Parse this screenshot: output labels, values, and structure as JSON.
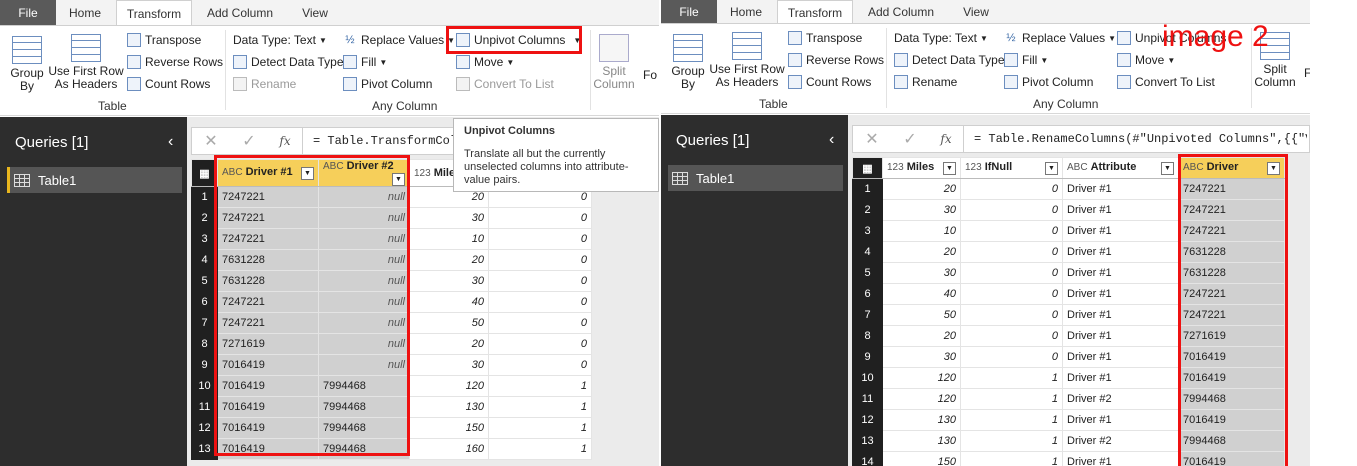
{
  "left": {
    "menu": {
      "file": "File",
      "tabs": [
        "Home",
        "Transform",
        "Add Column",
        "View"
      ],
      "active": "Transform"
    },
    "ribbon": {
      "group_by": "Group By",
      "use_first_row": "Use First Row As Headers",
      "transpose": "Transpose",
      "reverse_rows": "Reverse Rows",
      "count_rows": "Count Rows",
      "table_group": "Table",
      "data_type": "Data Type: Text",
      "detect_data_type": "Detect Data Type",
      "rename": "Rename",
      "replace_values": "Replace Values",
      "fill": "Fill",
      "pivot_column": "Pivot Column",
      "unpivot_columns": "Unpivot Columns",
      "move": "Move",
      "convert_to_list": "Convert To List",
      "any_column_group": "Any Column",
      "split_column": "Split Column",
      "fo_partial": "Fo"
    },
    "queries": {
      "title": "Queries [1]",
      "items": [
        "Table1"
      ]
    },
    "formula": "= Table.TransformColu",
    "tooltip": {
      "title": "Unpivot Columns",
      "body": "Translate all but the currently unselected columns into attribute-value pairs."
    },
    "columns": [
      {
        "type": "ABC",
        "name": "Driver #1"
      },
      {
        "type": "ABC",
        "name": "Driver #2"
      },
      {
        "type": "123",
        "name": "Mile"
      },
      {
        "type": "",
        "name": ""
      }
    ],
    "rows": [
      [
        "1",
        "7247221",
        "null",
        "20",
        "0"
      ],
      [
        "2",
        "7247221",
        "null",
        "30",
        "0"
      ],
      [
        "3",
        "7247221",
        "null",
        "10",
        "0"
      ],
      [
        "4",
        "7631228",
        "null",
        "20",
        "0"
      ],
      [
        "5",
        "7631228",
        "null",
        "30",
        "0"
      ],
      [
        "6",
        "7247221",
        "null",
        "40",
        "0"
      ],
      [
        "7",
        "7247221",
        "null",
        "50",
        "0"
      ],
      [
        "8",
        "7271619",
        "null",
        "20",
        "0"
      ],
      [
        "9",
        "7016419",
        "null",
        "30",
        "0"
      ],
      [
        "10",
        "7016419",
        "7994468",
        "120",
        "1"
      ],
      [
        "11",
        "7016419",
        "7994468",
        "130",
        "1"
      ],
      [
        "12",
        "7016419",
        "7994468",
        "150",
        "1"
      ],
      [
        "13",
        "7016419",
        "7994468",
        "160",
        "1"
      ]
    ]
  },
  "right": {
    "menu": {
      "file": "File",
      "tabs": [
        "Home",
        "Transform",
        "Add Column",
        "View"
      ],
      "active": "Transform"
    },
    "ribbon": {
      "group_by": "Group By",
      "use_first_row": "Use First Row As Headers",
      "transpose": "Transpose",
      "reverse_rows": "Reverse Rows",
      "count_rows": "Count Rows",
      "table_group": "Table",
      "data_type": "Data Type: Text",
      "detect_data_type": "Detect Data Type",
      "rename": "Rename",
      "replace_values": "Replace Values",
      "fill": "Fill",
      "pivot_column": "Pivot Column",
      "unpivot_columns": "Unpivot Columns",
      "move": "Move",
      "convert_to_list": "Convert To List",
      "any_column_group": "Any Column",
      "split_column": "Split Column",
      "f_partial": "F"
    },
    "annotation": "image 2",
    "queries": {
      "title": "Queries [1]",
      "items": [
        "Table1"
      ]
    },
    "formula": "= Table.RenameColumns(#\"Unpivoted Columns\",{{\"Value",
    "columns": [
      {
        "type": "123",
        "name": "Miles"
      },
      {
        "type": "123",
        "name": "IfNull"
      },
      {
        "type": "ABC",
        "name": "Attribute"
      },
      {
        "type": "ABC",
        "name": "Driver"
      }
    ],
    "rows": [
      [
        "1",
        "20",
        "0",
        "Driver #1",
        "7247221"
      ],
      [
        "2",
        "30",
        "0",
        "Driver #1",
        "7247221"
      ],
      [
        "3",
        "10",
        "0",
        "Driver #1",
        "7247221"
      ],
      [
        "4",
        "20",
        "0",
        "Driver #1",
        "7631228"
      ],
      [
        "5",
        "30",
        "0",
        "Driver #1",
        "7631228"
      ],
      [
        "6",
        "40",
        "0",
        "Driver #1",
        "7247221"
      ],
      [
        "7",
        "50",
        "0",
        "Driver #1",
        "7247221"
      ],
      [
        "8",
        "20",
        "0",
        "Driver #1",
        "7271619"
      ],
      [
        "9",
        "30",
        "0",
        "Driver #1",
        "7016419"
      ],
      [
        "10",
        "120",
        "1",
        "Driver #1",
        "7016419"
      ],
      [
        "11",
        "120",
        "1",
        "Driver #2",
        "7994468"
      ],
      [
        "12",
        "130",
        "1",
        "Driver #1",
        "7016419"
      ],
      [
        "13",
        "130",
        "1",
        "Driver #2",
        "7994468"
      ],
      [
        "14",
        "150",
        "1",
        "Driver #1",
        "7016419"
      ]
    ]
  }
}
